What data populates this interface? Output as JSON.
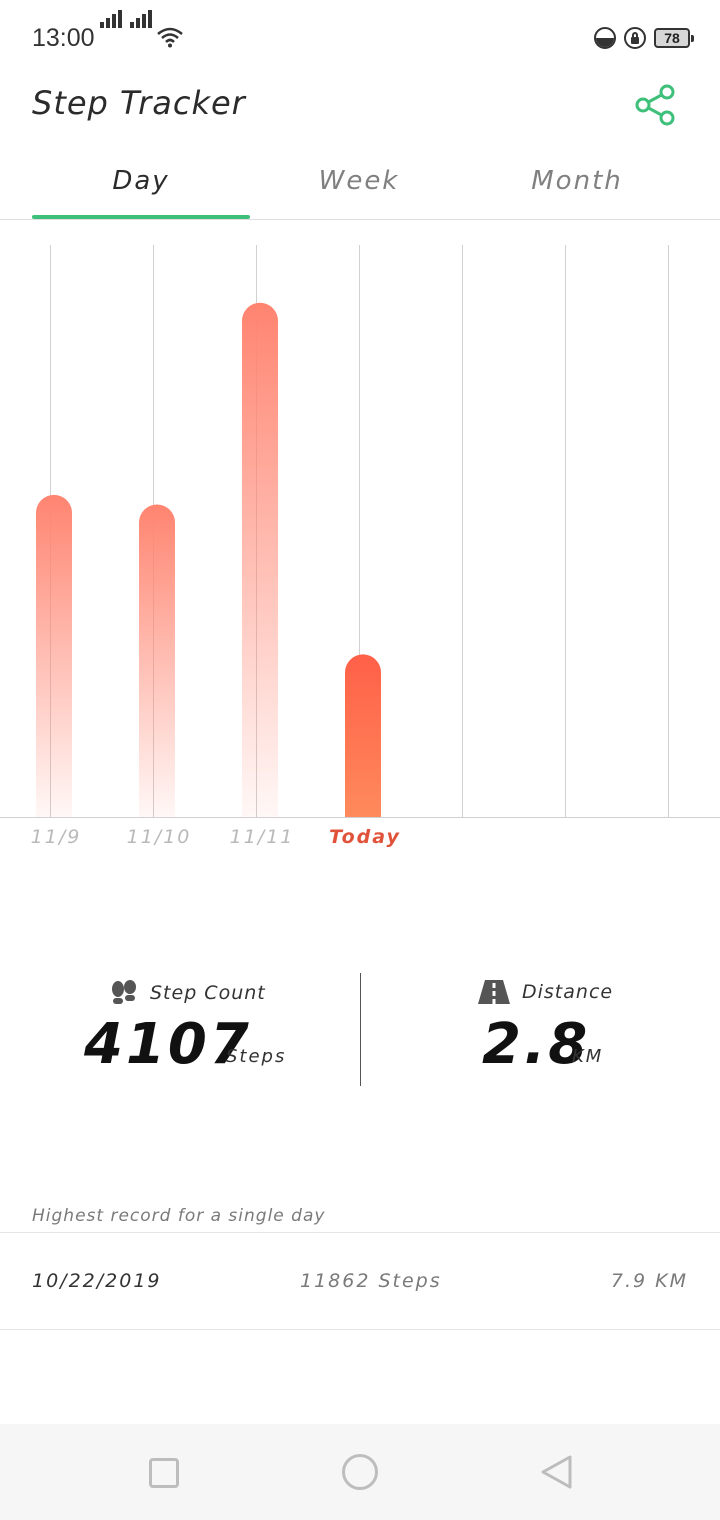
{
  "status_bar": {
    "time": "13:00",
    "battery": "78"
  },
  "header": {
    "title": "Step Tracker"
  },
  "tabs": [
    {
      "label": "Day",
      "active": true
    },
    {
      "label": "Week",
      "active": false
    },
    {
      "label": "Month",
      "active": false
    }
  ],
  "chart_data": {
    "type": "bar",
    "categories": [
      "11/9",
      "11/10",
      "11/11",
      "Today"
    ],
    "values": [
      5350,
      5190,
      8540,
      2700
    ],
    "highlight_category": "Today",
    "colors": {
      "bar_top": "#ff8470",
      "bar_highlight": "#ff6048",
      "bar_highlight_bottom": "#ff8a5c",
      "today_label": "#e0533a",
      "grid": "#d0d0d0"
    }
  },
  "stats": {
    "steps": {
      "label": "Step Count",
      "value": "4107",
      "unit": "Steps",
      "icon": "footprints-icon"
    },
    "distance": {
      "label": "Distance",
      "value": "2.8",
      "unit": "KM",
      "icon": "road-icon"
    }
  },
  "record": {
    "title": "Highest record for a single day",
    "date": "10/22/2019",
    "steps": "11862 Steps",
    "distance": "7.9 KM"
  },
  "colors": {
    "accent": "#3ec07a"
  }
}
